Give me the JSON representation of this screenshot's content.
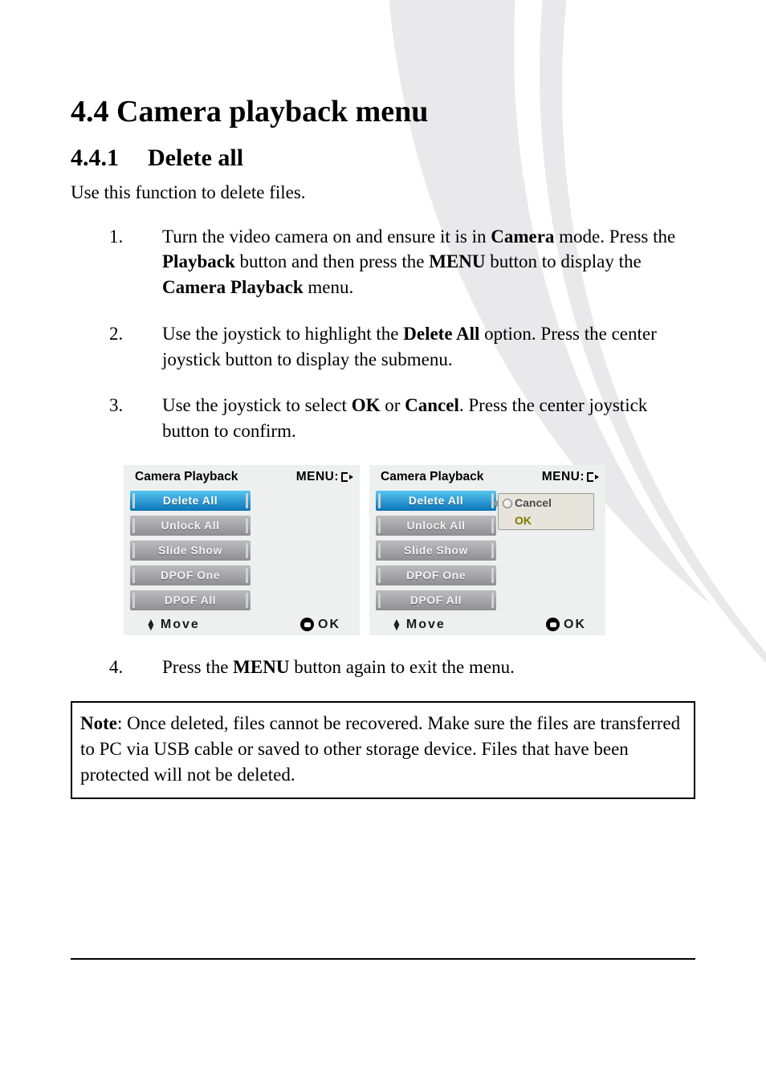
{
  "heading": "4.4 Camera playback menu",
  "subheading_num": "4.4.1",
  "subheading_title": "Delete all",
  "intro": "Use this function to delete files.",
  "steps": [
    {
      "n": "1.",
      "parts": [
        "Turn the video camera on and ensure it is in ",
        {
          "b": "Camera"
        },
        " mode. Press the ",
        {
          "b": "Playback"
        },
        " button and then press the ",
        {
          "b": "MENU"
        },
        " button to display the ",
        {
          "b": "Camera Playback"
        },
        " menu."
      ]
    },
    {
      "n": "2.",
      "parts": [
        "Use the joystick to highlight the ",
        {
          "b": "Delete All"
        },
        " option. Press the center joystick button to display the submenu."
      ]
    },
    {
      "n": "3.",
      "parts": [
        "Use the joystick to select ",
        {
          "b": "OK"
        },
        " or ",
        {
          "b": "Cancel"
        },
        ". Press the center joystick button to confirm."
      ]
    }
  ],
  "step4": {
    "n": "4.",
    "parts": [
      "Press the ",
      {
        "b": "MENU"
      },
      " button again to exit the menu."
    ]
  },
  "note_label": "Note",
  "note_body": ": Once deleted, files cannot be recovered. Make sure the files are transferred to PC via USB cable or saved to other storage device. Files that have been protected will not be deleted.",
  "lcd": {
    "title": "Camera Playback",
    "menu_label": "MENU:",
    "items": [
      "Delete All",
      "Unlock All",
      "Slide Show",
      "DPOF One",
      "DPOF All"
    ],
    "selected_index": 0,
    "move": "Move",
    "ok": "OK",
    "flyout": {
      "cancel": "Cancel",
      "ok": "OK"
    }
  }
}
